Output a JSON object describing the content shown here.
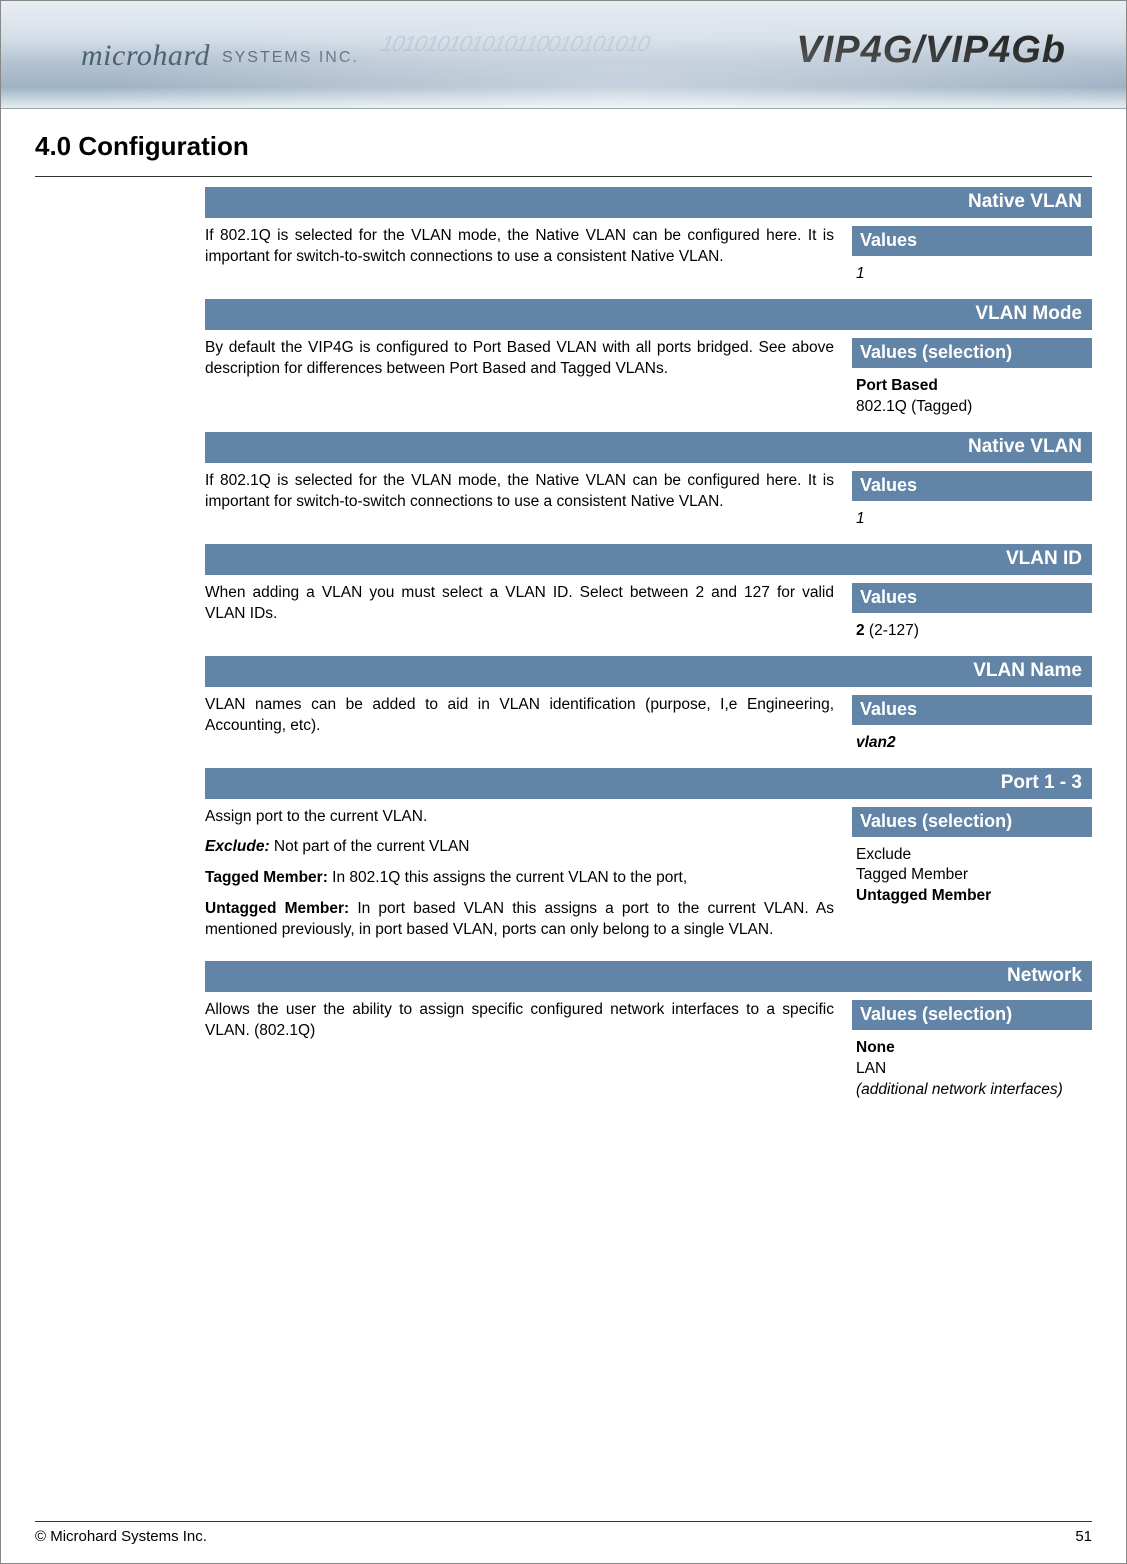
{
  "header": {
    "brand_primary": "microhard",
    "brand_secondary": "SYSTEMS INC.",
    "product": "VIP4G/VIP4Gb",
    "binary_art": "101010101010110010101010"
  },
  "heading": "4.0  Configuration",
  "sections": [
    {
      "title": "Native VLAN",
      "description": "If 802.1Q is selected for the VLAN mode, the Native VLAN can be configured here. It is important for switch-to-switch connections to use a consistent Native VLAN.",
      "values_header": "Values",
      "values": [
        {
          "text": "1",
          "style": "italic"
        }
      ]
    },
    {
      "title": "VLAN Mode",
      "description": "By default the VIP4G is configured to Port Based VLAN with all ports bridged.  See above description for differences between Port Based and Tagged VLANs.",
      "values_header": "Values (selection)",
      "values": [
        {
          "text": "Port Based",
          "style": "bold"
        },
        {
          "text": "802.1Q (Tagged)",
          "style": ""
        }
      ]
    },
    {
      "title": "Native VLAN",
      "description": "If 802.1Q is selected for the VLAN mode, the Native VLAN can be configured here. It is important for switch-to-switch connections to use a consistent Native VLAN.",
      "values_header": "Values",
      "values": [
        {
          "text": "1",
          "style": "italic"
        }
      ]
    },
    {
      "title": "VLAN ID",
      "description": "When adding a VLAN you must select a VLAN ID. Select between 2 and 127 for valid VLAN IDs.",
      "values_header": "Values",
      "values": [
        {
          "text": "2",
          "style": "bold",
          "suffix": " (2-127)"
        }
      ]
    },
    {
      "title": "VLAN Name",
      "description": "VLAN names can be added to aid in VLAN identification (purpose, I,e Engineering, Accounting, etc).",
      "values_header": "Values",
      "values": [
        {
          "text": "vlan2",
          "style": "bold italic"
        }
      ]
    },
    {
      "title": "Port 1 - 3",
      "description_parts": [
        {
          "type": "plain",
          "text": "Assign port to the current VLAN."
        },
        {
          "type": "term_block",
          "term": "Exclude:",
          "rest": "   Not part of the current VLAN"
        },
        {
          "type": "bold_block",
          "term": "Tagged Member:",
          "rest": " In 802.1Q this assigns the current VLAN to the port,"
        },
        {
          "type": "bold_block",
          "term": "Untagged Member:",
          "rest": " In port based VLAN this assigns a port to the current VLAN. As mentioned previously, in port based VLAN, ports can only belong to a single VLAN."
        }
      ],
      "values_header": "Values (selection)",
      "values": [
        {
          "text": "Exclude",
          "style": ""
        },
        {
          "text": "Tagged Member",
          "style": ""
        },
        {
          "text": "Untagged Member",
          "style": "bold"
        }
      ]
    },
    {
      "title": "Network",
      "description": "Allows the user the ability to assign specific configured network interfaces to a specific VLAN. (802.1Q)",
      "values_header": "Values  (selection)",
      "values": [
        {
          "text": "None",
          "style": "bold"
        },
        {
          "text": "LAN",
          "style": ""
        },
        {
          "text": "(additional network interfaces)",
          "style": "italic"
        }
      ]
    }
  ],
  "footer": {
    "copyright": "© Microhard Systems Inc.",
    "page_number": "51"
  }
}
